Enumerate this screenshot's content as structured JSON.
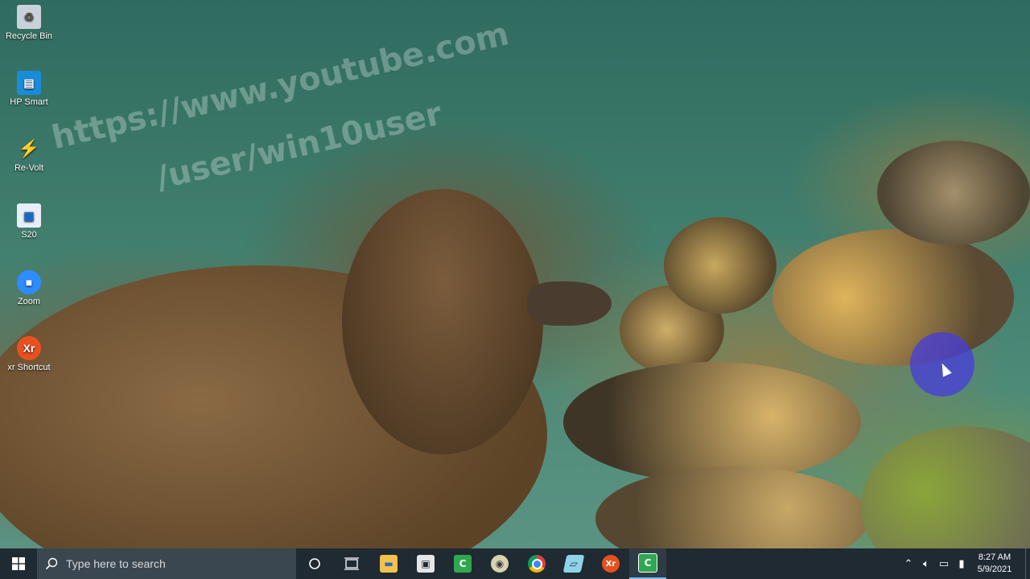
{
  "desktop_icons": [
    {
      "label": "Recycle Bin",
      "icon": "recycle-bin-icon",
      "color": "#c9d2da",
      "glyph": "♻"
    },
    {
      "label": "HP Smart",
      "icon": "hp-smart-icon",
      "color": "#1a8bd6",
      "glyph": "▤"
    },
    {
      "label": "Re-Volt",
      "icon": "re-volt-icon",
      "color": "#e8562a",
      "glyph": "⚡"
    },
    {
      "label": "S20",
      "icon": "s20-icon",
      "color": "#1e6fd0",
      "glyph": "▦"
    },
    {
      "label": "Zoom",
      "icon": "zoom-icon",
      "color": "#2d8cff",
      "glyph": "■"
    },
    {
      "label": "xr Shortcut",
      "icon": "xr-shortcut-icon",
      "color": "#e8501f",
      "glyph": "Xr"
    }
  ],
  "watermark": {
    "line1": "https://www.youtube.com",
    "line2": "/user/win10user"
  },
  "taskbar": {
    "search_placeholder": "Type here to search",
    "apps": [
      {
        "name": "file-explorer",
        "icon": "folder-icon",
        "color": "#f2c14e",
        "glyph": "▬"
      },
      {
        "name": "microsoft-store",
        "icon": "store-icon",
        "color": "#e6e6e6",
        "glyph": "▣"
      },
      {
        "name": "camtasia",
        "icon": "camtasia-icon",
        "color": "#2fa84f",
        "glyph": "C"
      },
      {
        "name": "xr-app",
        "icon": "eye-icon",
        "color": "#d9d2b0",
        "glyph": "◉"
      },
      {
        "name": "chrome",
        "icon": "chrome-icon",
        "color": "#4285f4",
        "glyph": "◎"
      },
      {
        "name": "notepad-like",
        "icon": "notepad-icon",
        "color": "#8fd3e8",
        "glyph": "▱"
      },
      {
        "name": "xr-shortcut",
        "icon": "xr-icon",
        "color": "#e8501f",
        "glyph": "Xr"
      },
      {
        "name": "camtasia-active",
        "icon": "camtasia-active-icon",
        "color": "#2fa84f",
        "glyph": "C"
      }
    ],
    "time": "8:27 AM",
    "date": "5/9/2021"
  }
}
